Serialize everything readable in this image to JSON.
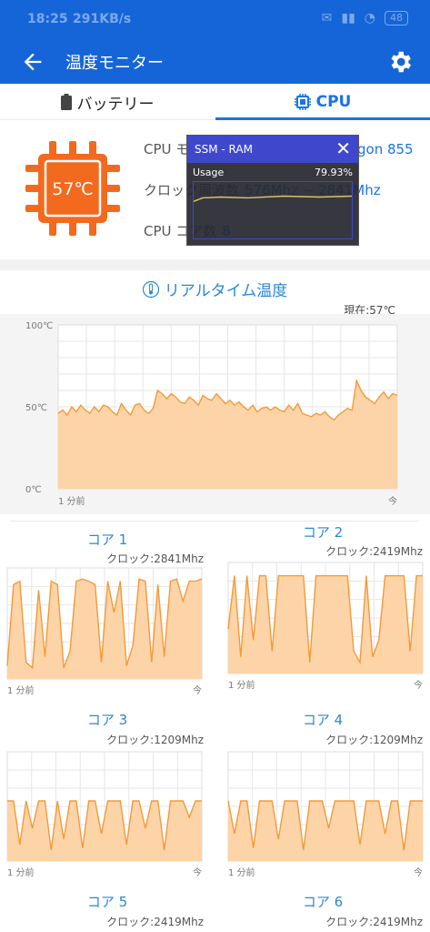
{
  "status_bar": {
    "time": "18:25",
    "speed": "291KB/s",
    "battery": "48"
  },
  "app_bar": {
    "title": "温度モニター"
  },
  "tabs": [
    {
      "label": "バッテリー"
    },
    {
      "label": "CPU"
    }
  ],
  "cpu_info": {
    "temp": "57℃",
    "model_label": "CPU モデル",
    "model_value": "Qualcomm Snapdragon 855",
    "clock_label": "クロック周波数",
    "clock_value": "576Mhz ~ 2841Mhz",
    "cores_label": "CPU コア数",
    "cores_value": "8"
  },
  "overlay": {
    "title": "SSM - RAM",
    "metric": "Usage",
    "value": "79.93%"
  },
  "realtime": {
    "title": "リアルタイム温度",
    "current": "現在:57℃",
    "y_labels": [
      "100℃",
      "50℃",
      "0℃"
    ],
    "x_left": "1 分前",
    "x_right": "今"
  },
  "chart_data": [
    {
      "type": "area",
      "title": "リアルタイム温度",
      "ylim": [
        0,
        100
      ],
      "yticks": [
        "0℃",
        "50℃",
        "100℃"
      ],
      "xticks": [
        "1 分前",
        "今"
      ],
      "values": [
        46,
        48,
        45,
        50,
        47,
        51,
        48,
        46,
        50,
        47,
        51,
        50,
        47,
        45,
        52,
        48,
        45,
        51,
        52,
        48,
        46,
        49,
        60,
        58,
        55,
        58,
        56,
        53,
        52,
        56,
        54,
        51,
        57,
        55,
        54,
        58,
        55,
        52,
        54,
        51,
        53,
        50,
        48,
        51,
        47,
        49,
        50,
        48,
        50,
        48,
        47,
        51,
        48,
        52,
        46,
        45,
        44,
        46,
        45,
        47,
        44,
        42,
        45,
        47,
        49,
        48,
        66,
        60,
        56,
        54,
        52,
        56,
        59,
        55,
        58,
        57
      ]
    },
    {
      "type": "area",
      "title": "コア 1",
      "values": [
        12,
        85,
        88,
        15,
        10,
        80,
        20,
        88,
        85,
        10,
        25,
        88,
        90,
        88,
        85,
        15,
        88,
        60,
        88,
        12,
        30,
        90,
        88,
        15,
        85,
        20,
        88,
        90,
        70,
        88,
        88,
        90
      ]
    },
    {
      "type": "area",
      "title": "コア 2",
      "values": [
        40,
        88,
        15,
        88,
        30,
        88,
        88,
        20,
        88,
        88,
        88,
        88,
        88,
        10,
        88,
        88,
        88,
        88,
        88,
        88,
        20,
        10,
        88,
        15,
        30,
        88,
        88,
        88,
        88,
        20,
        88,
        88
      ]
    },
    {
      "type": "area",
      "title": "コア 3",
      "values": [
        55,
        55,
        15,
        55,
        30,
        55,
        55,
        10,
        55,
        20,
        55,
        55,
        12,
        55,
        55,
        25,
        55,
        55,
        55,
        15,
        55,
        55,
        30,
        55,
        55,
        10,
        55,
        55,
        55,
        40,
        55,
        55
      ]
    },
    {
      "type": "area",
      "title": "コア 4",
      "values": [
        55,
        25,
        55,
        55,
        12,
        55,
        55,
        55,
        20,
        55,
        55,
        55,
        10,
        55,
        55,
        55,
        30,
        55,
        55,
        55,
        55,
        15,
        55,
        55,
        55,
        25,
        55,
        55,
        10,
        55,
        55,
        55
      ]
    }
  ],
  "cores": [
    {
      "title": "コア 1",
      "clock": "クロック:2841Mhz",
      "x_left": "1 分前",
      "x_right": "今"
    },
    {
      "title": "コア 2",
      "clock": "クロック:2419Mhz",
      "x_left": "1 分前",
      "x_right": "今"
    },
    {
      "title": "コア 3",
      "clock": "クロック:1209Mhz",
      "x_left": "1 分前",
      "x_right": "今"
    },
    {
      "title": "コア 4",
      "clock": "クロック:1209Mhz",
      "x_left": "1 分前",
      "x_right": "今"
    },
    {
      "title": "コア 5",
      "clock": "クロック:2419Mhz"
    },
    {
      "title": "コア 6",
      "clock": "クロック:2419Mhz"
    }
  ],
  "colors": {
    "primary": "#1565d8",
    "accent": "#1a73e8",
    "chip": "#f36a1e",
    "line": "#f39a3a",
    "fill": "#fdd4a8"
  },
  "icons": {
    "back": "arrow-left-icon",
    "settings": "gear-icon",
    "battery_tab": "battery-icon",
    "cpu_tab": "cpu-chip-icon",
    "thermometer": "thermometer-icon"
  }
}
